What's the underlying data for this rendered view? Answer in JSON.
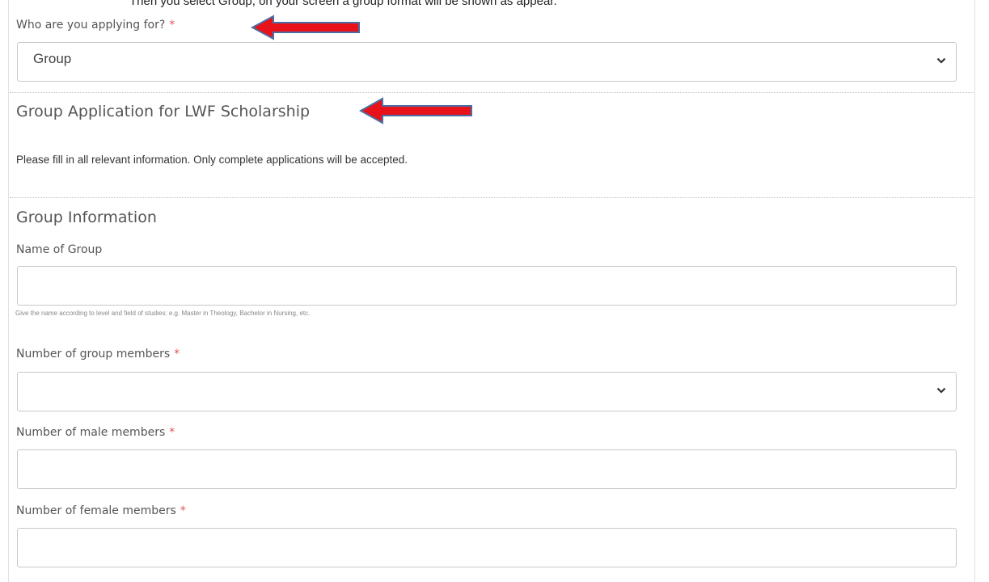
{
  "top_cut_text": "Then you select Group, on your screen a group format will be shown as appear.",
  "applying": {
    "label": "Who are you applying for?",
    "required": "*",
    "value": "Group"
  },
  "section": {
    "title": "Group Application for LWF Scholarship",
    "instructions": "Please fill in all relevant information. Only complete applications will be accepted."
  },
  "group_info": {
    "title": "Group Information",
    "name_label": "Name of Group",
    "name_value": "",
    "name_hint": "Give the name according to level and field of studies: e.g. Master in Theology, Bachelor in Nursing, etc.",
    "members_label": "Number of group members",
    "members_required": "*",
    "members_value": "",
    "male_label": "Number of male members",
    "male_required": "*",
    "male_value": "",
    "female_label": "Number of female members",
    "female_required": "*",
    "female_value": ""
  },
  "colors": {
    "annotation_arrow": "#e8121b",
    "arrow_outline": "#4a6fa5",
    "required": "#e05656"
  },
  "icons": {
    "dropdown": "chevron-down-icon",
    "annotation": "arrow-left-annotation-icon"
  }
}
